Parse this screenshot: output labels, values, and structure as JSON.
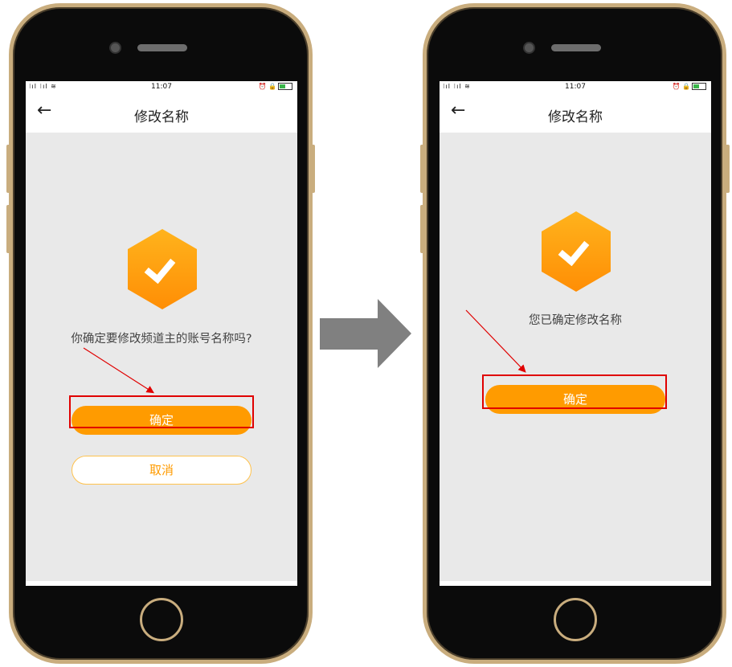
{
  "left_screen": {
    "status": {
      "signal": "⁝ıl ⁝ıl ≋",
      "time": "11:07",
      "icons": "⏰ 🔒"
    },
    "nav": {
      "back": "←",
      "title": "修改名称"
    },
    "message": "你确定要修改频道主的账号名称吗?",
    "confirm_label": "确定",
    "cancel_label": "取消"
  },
  "right_screen": {
    "status": {
      "signal": "⁝ıl ⁝ıl ≋",
      "time": "11:07",
      "icons": "⏰ 🔒"
    },
    "nav": {
      "back": "←",
      "title": "修改名称"
    },
    "message": "您已确定修改名称",
    "confirm_label": "确定"
  },
  "colors": {
    "accent": "#ff9b00",
    "annotation": "#e00000",
    "frame": "#c9ad7e",
    "arrow": "#808080"
  }
}
